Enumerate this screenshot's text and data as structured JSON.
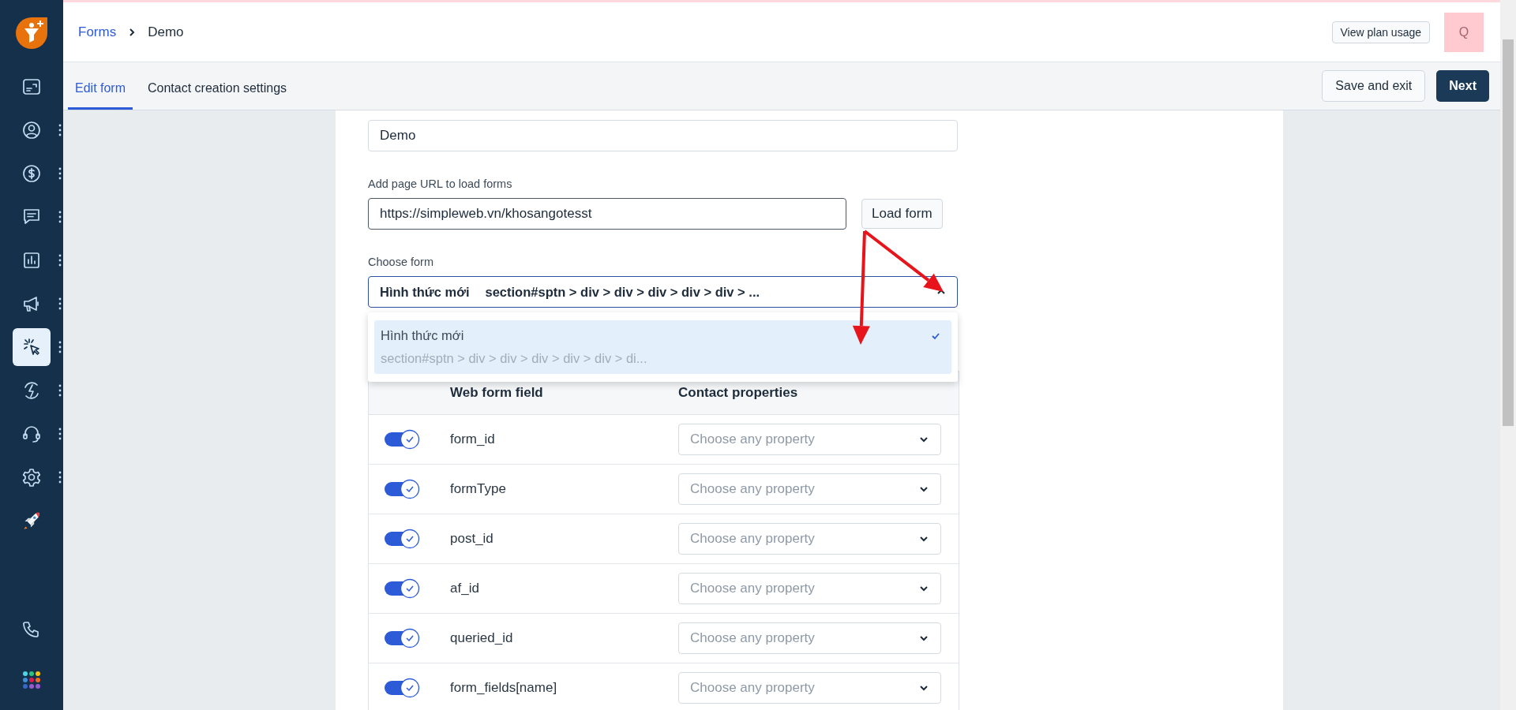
{
  "sidebar": {
    "items": [
      {
        "kind": "card",
        "selected": false,
        "menu": false
      },
      {
        "kind": "user",
        "selected": false,
        "menu": true
      },
      {
        "kind": "dollar",
        "selected": false,
        "menu": true
      },
      {
        "kind": "chat",
        "selected": false,
        "menu": true
      },
      {
        "kind": "chart",
        "selected": false,
        "menu": true
      },
      {
        "kind": "megaphone",
        "selected": false,
        "menu": true
      },
      {
        "kind": "cursor",
        "selected": true,
        "menu": true
      },
      {
        "kind": "bolt",
        "selected": false,
        "menu": true
      },
      {
        "kind": "headset",
        "selected": false,
        "menu": true
      },
      {
        "kind": "gear",
        "selected": false,
        "menu": true
      },
      {
        "kind": "rocket",
        "selected": false,
        "menu": false
      }
    ],
    "bottom_items": [
      {
        "kind": "phone"
      },
      {
        "kind": "apps"
      }
    ]
  },
  "breadcrumb": {
    "parent": "Forms",
    "current": "Demo"
  },
  "header": {
    "plan_button": "View plan usage",
    "avatar": "Q"
  },
  "tabs": [
    {
      "label": "Edit form",
      "selected": true
    },
    {
      "label": "Contact creation settings",
      "selected": false
    }
  ],
  "actions": {
    "save": "Save and exit",
    "next": "Next"
  },
  "form": {
    "name_value": "Demo",
    "url_label": "Add page URL to load forms",
    "url_value": "https://simpleweb.vn/khosangotesst",
    "load_button": "Load form",
    "choose_label": "Choose form",
    "selected_name": "Hình thức mới",
    "selected_path": "section#sptn > div > div > div > div > div > ...",
    "expanded": true,
    "options": [
      {
        "name": "Hình thức mới",
        "path": "section#sptn > div > div > div > div > div > di...",
        "selected": true
      }
    ]
  },
  "table": {
    "columns": [
      "Web form field",
      "Contact properties"
    ],
    "rows": [
      {
        "field": "form_id",
        "on": true,
        "placeholder": "Choose any property"
      },
      {
        "field": "formType",
        "on": true,
        "placeholder": "Choose any property"
      },
      {
        "field": "post_id",
        "on": true,
        "placeholder": "Choose any property"
      },
      {
        "field": "af_id",
        "on": true,
        "placeholder": "Choose any property"
      },
      {
        "field": "queried_id",
        "on": true,
        "placeholder": "Choose any property"
      },
      {
        "field": "form_fields[name]",
        "on": true,
        "placeholder": "Choose any property"
      }
    ]
  }
}
